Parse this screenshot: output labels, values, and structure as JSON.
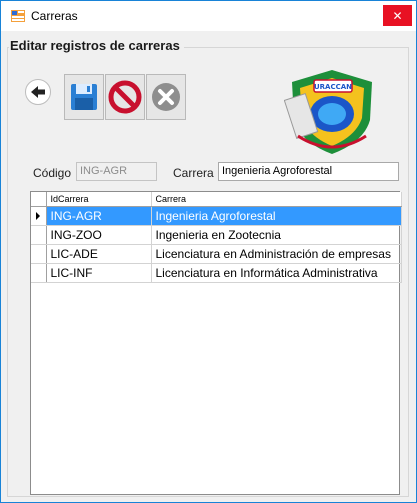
{
  "window": {
    "title": "Carreras",
    "close_glyph": "✕",
    "app_icon": "form-icon",
    "accent_color": "#1883d7",
    "close_color": "#e81123"
  },
  "group": {
    "title": "Editar registros de carreras"
  },
  "toolbar": {
    "back_icon": "arrow-left-icon",
    "save_icon": "floppy-disk-icon",
    "cancel_icon": "no-entry-icon",
    "delete_icon": "x-circle-icon"
  },
  "logo": {
    "text": "URACCAN"
  },
  "form": {
    "codigo_label": "Código",
    "codigo_value": "ING-AGR",
    "carrera_label": "Carrera",
    "carrera_value": "Ingenieria Agroforestal"
  },
  "grid": {
    "columns": [
      "IdCarrera",
      "Carrera"
    ],
    "selected_color": "#3399ff",
    "rows": [
      {
        "id": "ING-AGR",
        "carrera": "Ingenieria Agroforestal",
        "selected": true
      },
      {
        "id": "ING-ZOO",
        "carrera": "Ingenieria en Zootecnia",
        "selected": false
      },
      {
        "id": "LIC-ADE",
        "carrera": "Licenciatura en Administración de empresas",
        "selected": false
      },
      {
        "id": "LIC-INF",
        "carrera": "Licenciatura en Informática Administrativa",
        "selected": false
      }
    ]
  }
}
